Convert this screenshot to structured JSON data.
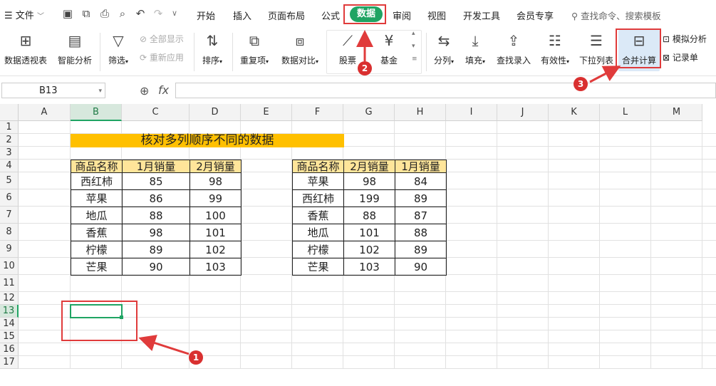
{
  "menubar": {
    "file_label": "文件",
    "tabs": [
      "开始",
      "插入",
      "页面布局",
      "公式",
      "数据",
      "审阅",
      "视图",
      "开发工具",
      "会员专享"
    ],
    "active_tab": "数据",
    "search_placeholder": "查找命令、搜索模板"
  },
  "ribbon": {
    "pivot": "数据透视表",
    "smart": "智能分析",
    "filter": "筛选",
    "show_all": "全部显示",
    "reapply": "重新应用",
    "sort": "排序",
    "duplicates": "重复项",
    "compare": "数据对比",
    "stock": "股票",
    "fund": "基金",
    "split": "分列",
    "fill": "填充",
    "lookup": "查找录入",
    "validity": "有效性",
    "dropdown": "下拉列表",
    "consolidate": "合并计算",
    "simulate": "模拟分析",
    "record": "记录单"
  },
  "formula_bar": {
    "name_box": "B13",
    "fx": "fx",
    "value": ""
  },
  "columns": [
    "A",
    "B",
    "C",
    "D",
    "E",
    "F",
    "G",
    "H",
    "I",
    "J",
    "K",
    "L",
    "M"
  ],
  "rows": [
    "1",
    "2",
    "3",
    "4",
    "5",
    "6",
    "7",
    "8",
    "9",
    "10",
    "11",
    "12",
    "13",
    "14",
    "15",
    "16",
    "17"
  ],
  "sheet": {
    "title": "核对多列顺序不同的数据",
    "table1": {
      "headers": [
        "商品名称",
        "1月销量",
        "2月销量"
      ],
      "rows": [
        [
          "西红柿",
          "85",
          "98"
        ],
        [
          "苹果",
          "86",
          "99"
        ],
        [
          "地瓜",
          "88",
          "100"
        ],
        [
          "香蕉",
          "98",
          "101"
        ],
        [
          "柠檬",
          "89",
          "102"
        ],
        [
          "芒果",
          "90",
          "103"
        ]
      ]
    },
    "table2": {
      "headers": [
        "商品名称",
        "2月销量",
        "1月销量"
      ],
      "rows": [
        [
          "苹果",
          "98",
          "84"
        ],
        [
          "西红柿",
          "199",
          "89"
        ],
        [
          "香蕉",
          "88",
          "87"
        ],
        [
          "地瓜",
          "101",
          "88"
        ],
        [
          "柠檬",
          "102",
          "89"
        ],
        [
          "芒果",
          "103",
          "90"
        ]
      ]
    }
  },
  "annotations": {
    "step1": "1",
    "step2": "2",
    "step3": "3",
    "color": "#e03b3b"
  },
  "colors": {
    "accent": "#1fa463",
    "title_fill": "#ffc000",
    "header_fill": "#ffe59a"
  }
}
